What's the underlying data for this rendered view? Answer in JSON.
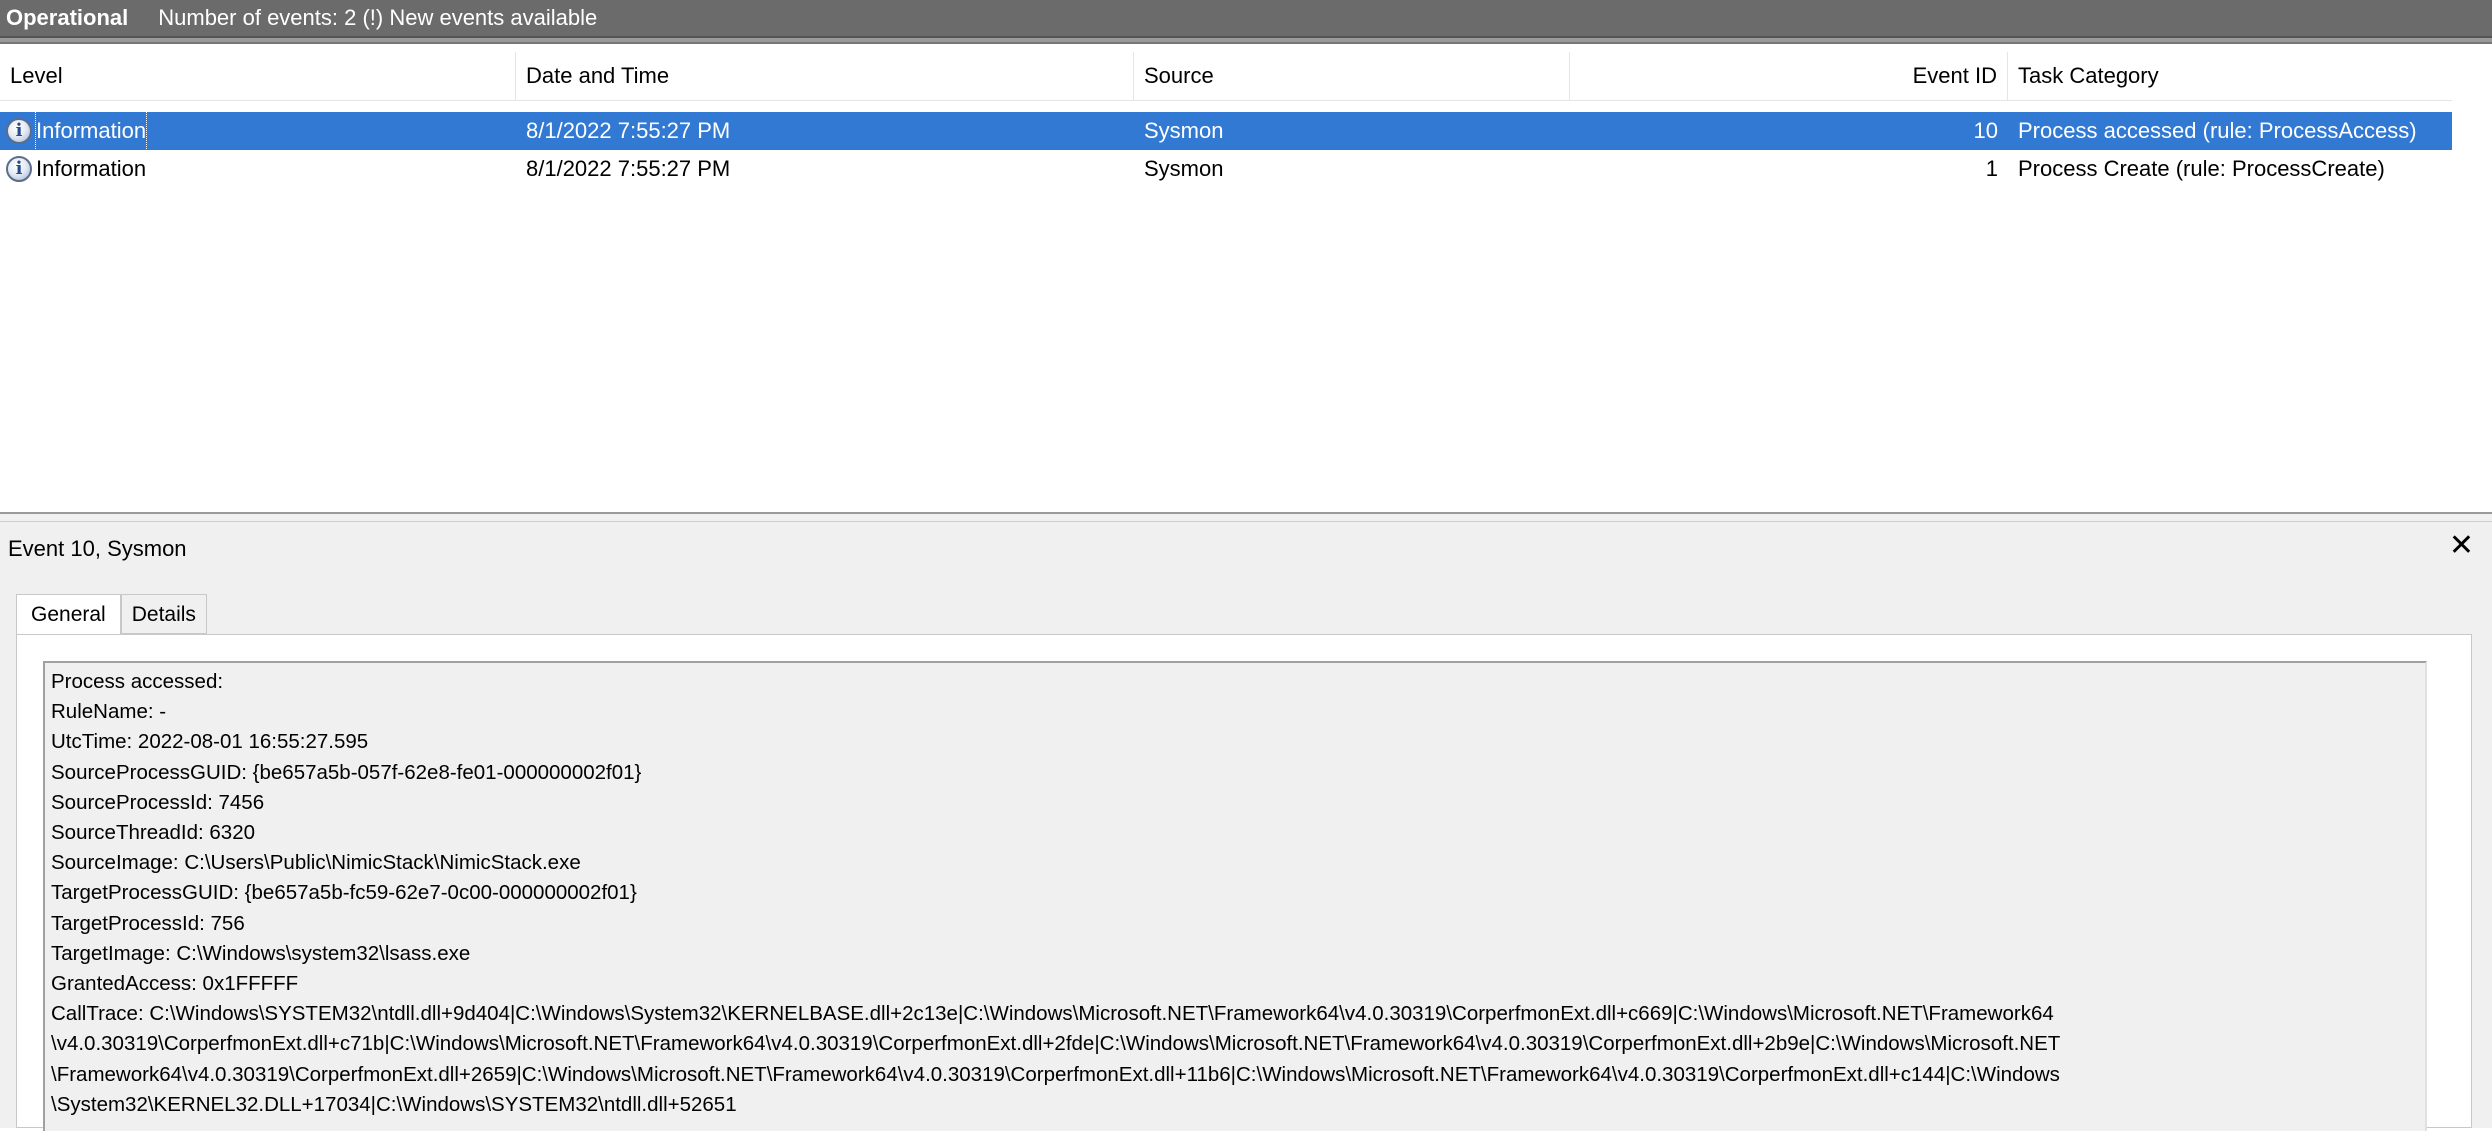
{
  "header": {
    "log_name": "Operational",
    "events_info": "Number of events: 2 (!) New events available"
  },
  "columns": {
    "level": "Level",
    "date": "Date and Time",
    "source": "Source",
    "event_id": "Event ID",
    "task": "Task Category"
  },
  "events": [
    {
      "level": "Information",
      "date": "8/1/2022 7:55:27 PM",
      "source": "Sysmon",
      "event_id": "10",
      "task": "Process accessed (rule: ProcessAccess)",
      "selected": true
    },
    {
      "level": "Information",
      "date": "8/1/2022 7:55:27 PM",
      "source": "Sysmon",
      "event_id": "1",
      "task": "Process Create (rule: ProcessCreate)",
      "selected": false
    }
  ],
  "details": {
    "title": "Event 10, Sysmon",
    "close_symbol": "✕",
    "tabs": [
      "General",
      "Details"
    ],
    "active_tab": "General",
    "lines": [
      "Process accessed:",
      "RuleName: -",
      "UtcTime: 2022-08-01 16:55:27.595",
      "SourceProcessGUID: {be657a5b-057f-62e8-fe01-000000002f01}",
      "SourceProcessId: 7456",
      "SourceThreadId: 6320",
      "SourceImage: C:\\Users\\Public\\NimicStack\\NimicStack.exe",
      "TargetProcessGUID: {be657a5b-fc59-62e7-0c00-000000002f01}",
      "TargetProcessId: 756",
      "TargetImage: C:\\Windows\\system32\\lsass.exe",
      "GrantedAccess: 0x1FFFFF",
      "CallTrace: C:\\Windows\\SYSTEM32\\ntdll.dll+9d404|C:\\Windows\\System32\\KERNELBASE.dll+2c13e|C:\\Windows\\Microsoft.NET\\Framework64\\v4.0.30319\\CorperfmonExt.dll+c669|C:\\Windows\\Microsoft.NET\\Framework64",
      "\\v4.0.30319\\CorperfmonExt.dll+c71b|C:\\Windows\\Microsoft.NET\\Framework64\\v4.0.30319\\CorperfmonExt.dll+2fde|C:\\Windows\\Microsoft.NET\\Framework64\\v4.0.30319\\CorperfmonExt.dll+2b9e|C:\\Windows\\Microsoft.NET",
      "\\Framework64\\v4.0.30319\\CorperfmonExt.dll+2659|C:\\Windows\\Microsoft.NET\\Framework64\\v4.0.30319\\CorperfmonExt.dll+11b6|C:\\Windows\\Microsoft.NET\\Framework64\\v4.0.30319\\CorperfmonExt.dll+c144|C:\\Windows",
      "\\System32\\KERNEL32.DLL+17034|C:\\Windows\\SYSTEM32\\ntdll.dll+52651"
    ]
  }
}
